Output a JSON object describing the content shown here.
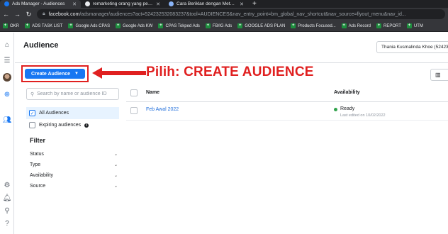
{
  "browser": {
    "tabs": [
      {
        "title": "Ads Manager - Audiences",
        "favicon_color": "#1877f2",
        "active": true
      },
      {
        "title": "remarketing orang yang pernah",
        "favicon_color": "#e8eaed",
        "active": false
      },
      {
        "title": "Cara Beriklan dengan Metode Re",
        "favicon_color": "#8ab4f8",
        "active": false
      }
    ],
    "new_tab_label": "+",
    "url_host": "facebook.com",
    "url_rest": "/adsmanager/audiences?act=524232532083237&tool=AUDIENCES&nav_entry_point=bm_global_nav_shortcut&nav_source=flyout_menu&nav_id...",
    "bookmarks": [
      "OKR",
      "ADS TASK LIST",
      "Google Ads CPAS",
      "Google Ads KW",
      "CPAS Tokped Ads",
      "FB/IG Ads",
      "GOOGLE ADS PLAN",
      "Products Focused...",
      "Ads Record",
      "REPORT",
      "UTM"
    ]
  },
  "header": {
    "title": "Audience",
    "account": "Thania Kusmalinda Khoe (52423"
  },
  "toolbar": {
    "create_label": "Create Audience",
    "annotation": "Pilih: CREATE AUDIENCE",
    "accent": "#1877f2",
    "annotation_color": "#e02020"
  },
  "sidebar": {
    "search_placeholder": "Search by name or audience ID",
    "options": [
      {
        "label": "All Audiences",
        "checked": true
      },
      {
        "label": "Expiring audiences",
        "checked": false
      }
    ],
    "filter_heading": "Filter",
    "filters": [
      "Status",
      "Type",
      "Availability",
      "Source"
    ]
  },
  "table": {
    "columns": [
      "Name",
      "Availability"
    ],
    "rows": [
      {
        "name": "Feb Awal 2022",
        "status": "Ready",
        "last_edited": "Last edited on 10/02/2022"
      }
    ]
  }
}
